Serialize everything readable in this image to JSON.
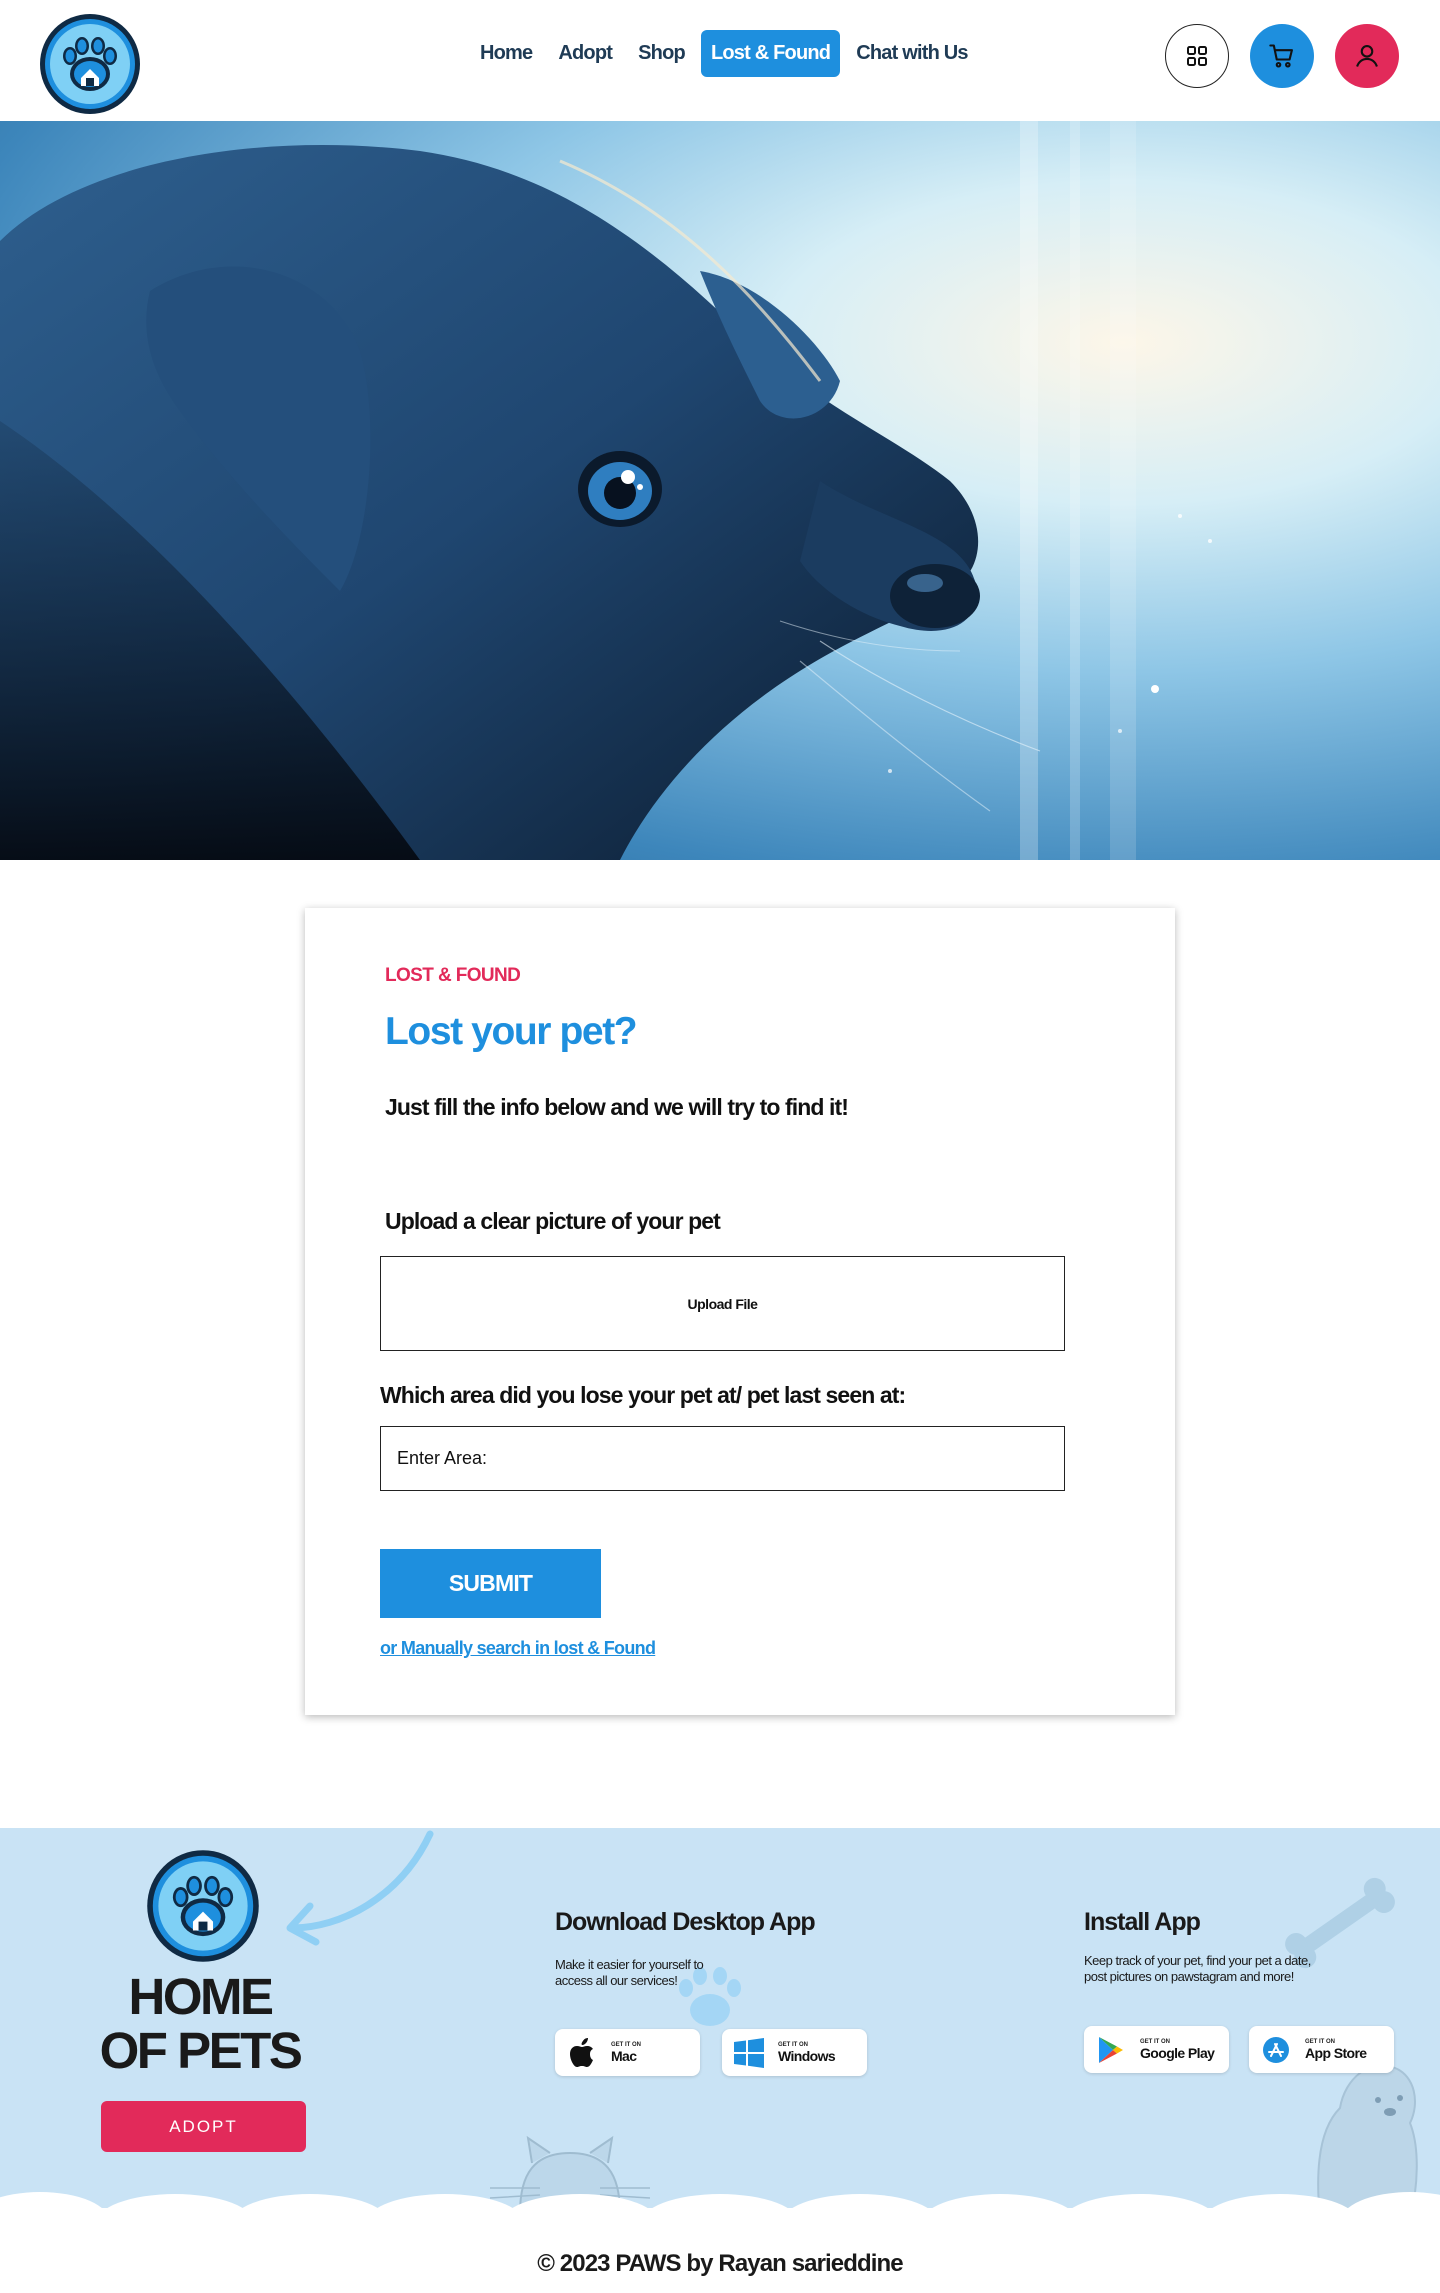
{
  "nav": {
    "items": [
      {
        "label": "Home",
        "active": false
      },
      {
        "label": "Adopt",
        "active": false
      },
      {
        "label": "Shop",
        "active": false
      },
      {
        "label": "Lost & Found",
        "active": true
      },
      {
        "label": "Chat with Us",
        "active": false
      }
    ],
    "icons": [
      "grid-icon",
      "cart-icon",
      "user-icon"
    ]
  },
  "form": {
    "eyebrow": "LOST & FOUND",
    "title": "Lost your pet?",
    "subtitle": "Just fill the info below and we will  try to find it!",
    "upload_label": "Upload a clear picture of your pet",
    "upload_button": "Upload File",
    "area_label": "Which area did you lose your pet at/ pet last seen at:",
    "area_placeholder": "Enter Area:",
    "submit_label": "SUBMIT",
    "manual_link": "or Manually search in lost & Found"
  },
  "footer": {
    "brand_line1": "HOME",
    "brand_line2": "OF PETS",
    "adopt_button": "ADOPT",
    "desktop": {
      "heading": "Download Desktop App",
      "text_line1": "Make it easier for yourself to",
      "text_line2": "access all our services!",
      "stores": [
        {
          "small": "GET IT ON",
          "name": "Mac"
        },
        {
          "small": "GET IT ON",
          "name": "Windows"
        }
      ]
    },
    "mobile": {
      "heading": "Install  App",
      "text_line1": "Keep track of your pet, find your pet a date,",
      "text_line2": "post pictures on pawstagram and more!",
      "stores": [
        {
          "small": "GET IT ON",
          "name": "Google Play"
        },
        {
          "small": "GET IT ON",
          "name": "App Store"
        }
      ]
    },
    "copyright": "© 2023 PAWS by Rayan sarieddine"
  },
  "colors": {
    "accent": "#1e8fde",
    "pink": "#e22a5a",
    "footer_bg": "#c9e3f5",
    "text_dark": "#1f3b55"
  }
}
